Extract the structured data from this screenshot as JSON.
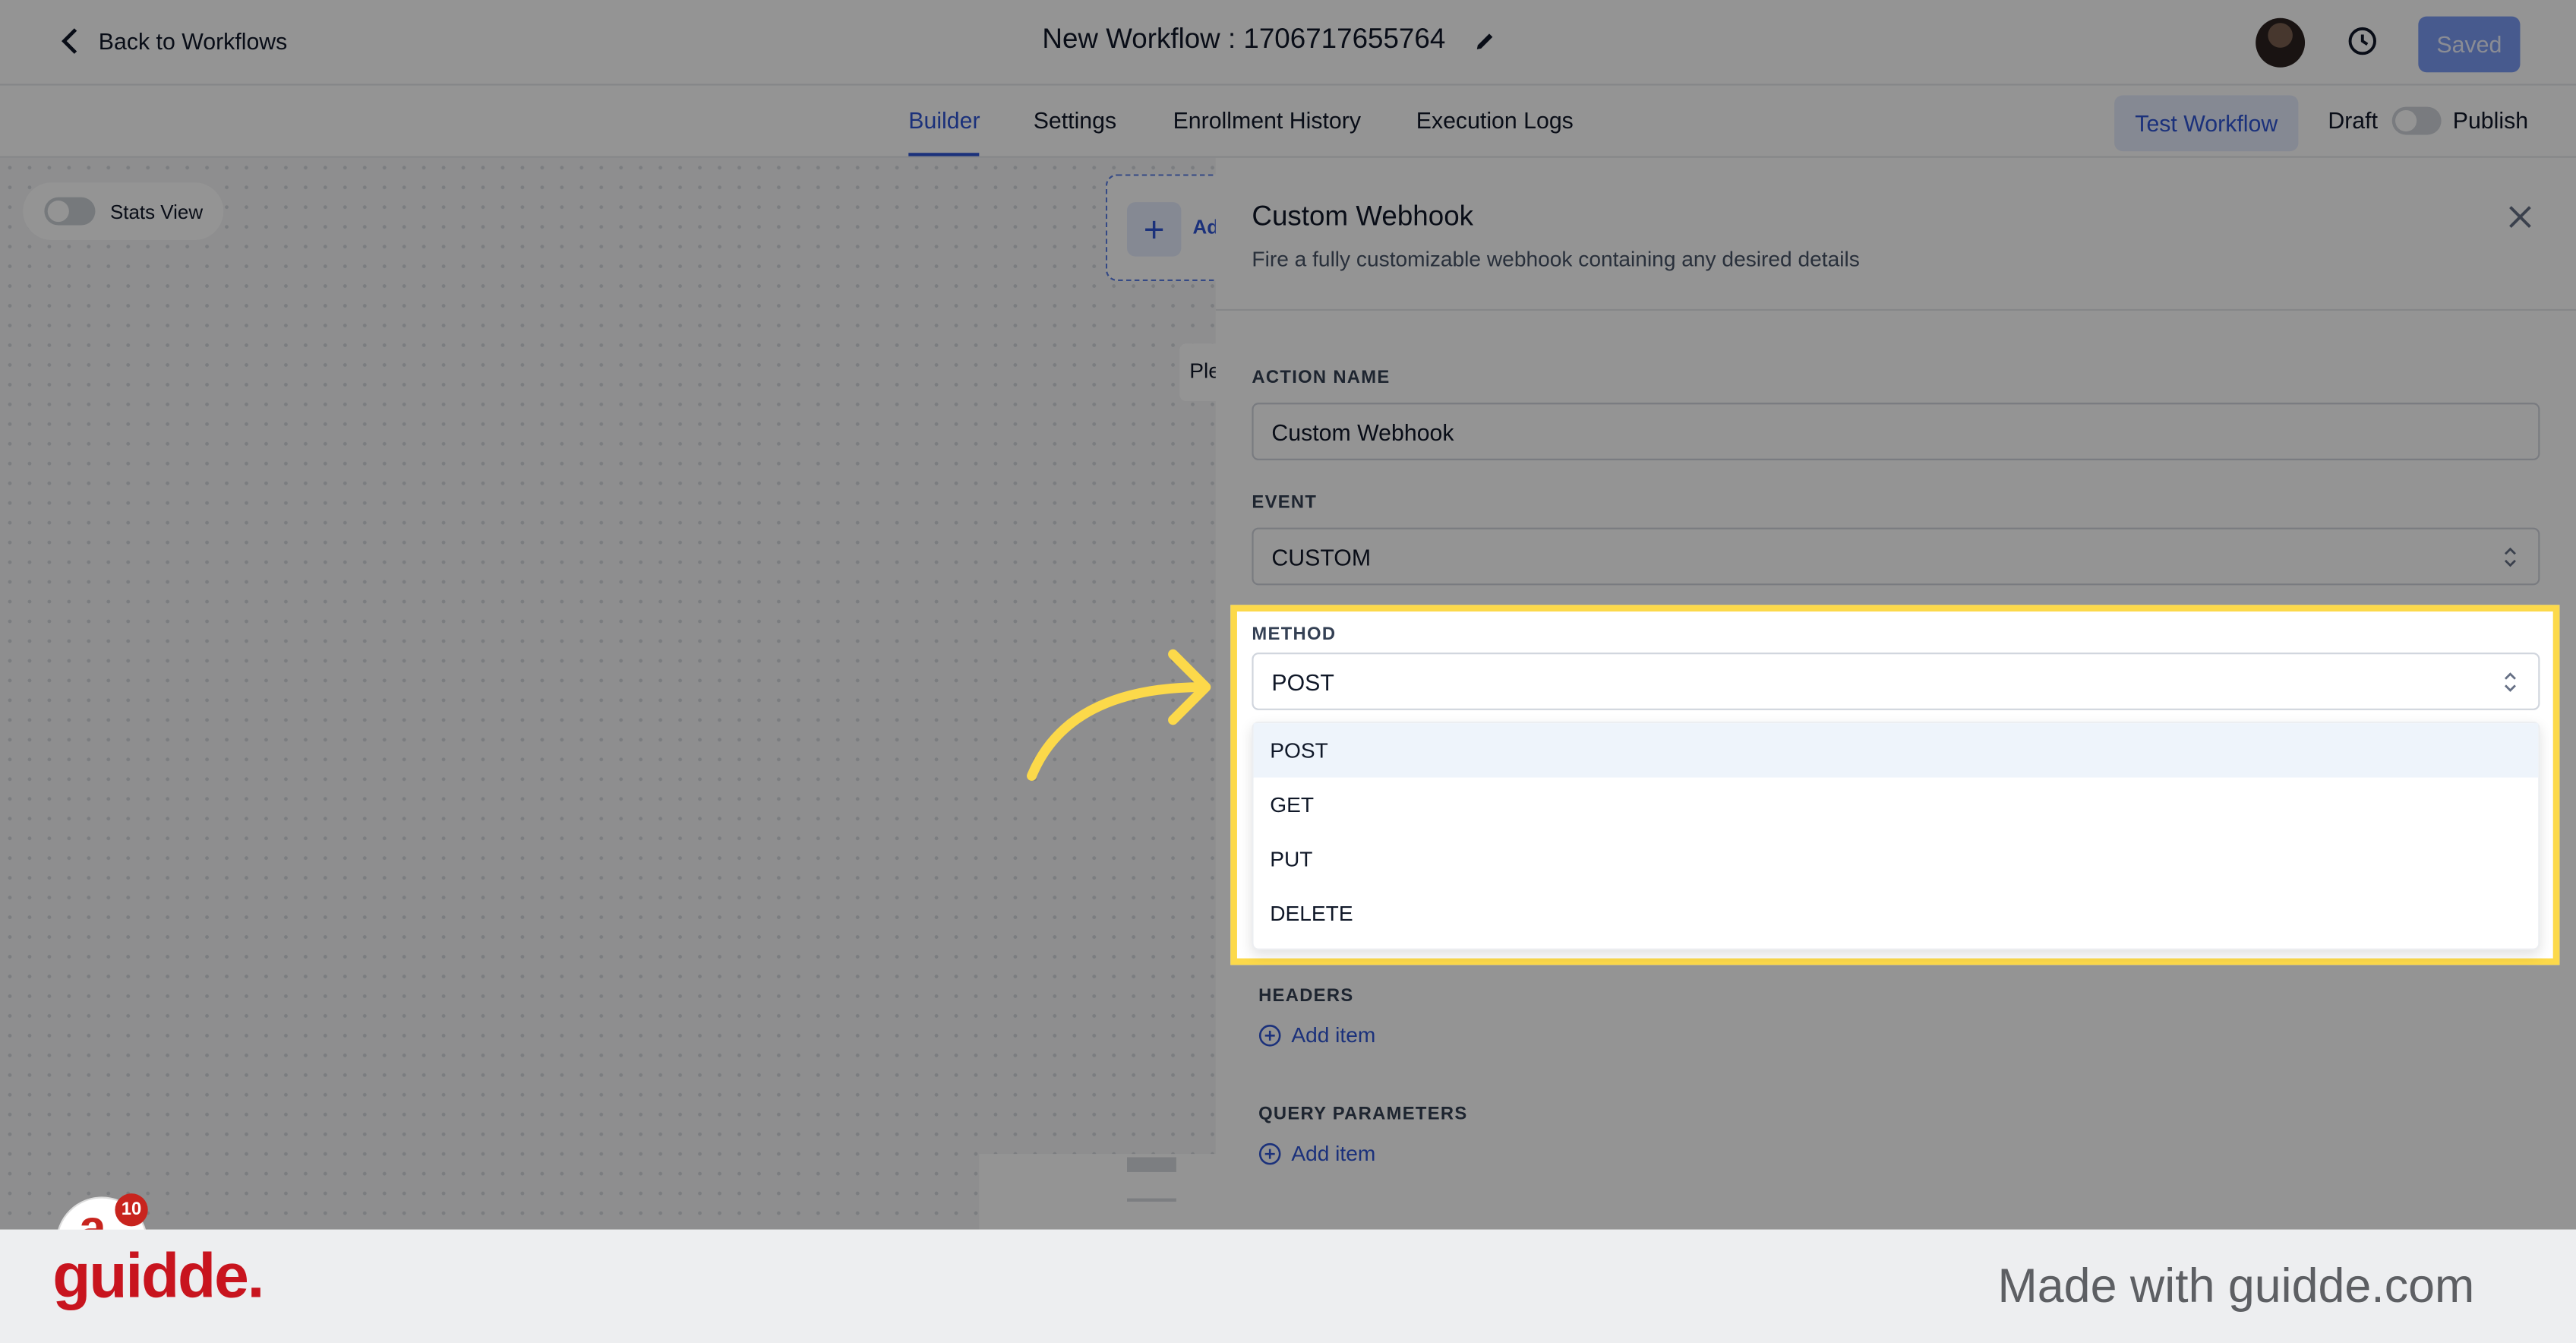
{
  "header": {
    "back_label": "Back to Workflows",
    "workflow_title": "New Workflow : 1706717655764",
    "saved_label": "Saved"
  },
  "tabs": [
    {
      "label": "Builder",
      "active": true
    },
    {
      "label": "Settings",
      "active": false
    },
    {
      "label": "Enrollment History",
      "active": false
    },
    {
      "label": "Execution Logs",
      "active": false
    }
  ],
  "toolbar": {
    "test_label": "Test Workflow",
    "draft_label": "Draft",
    "publish_label": "Publish",
    "publish_on": false
  },
  "canvas": {
    "stats_label": "Stats View",
    "add_node_label": "Ad",
    "partial_text": "Ple",
    "notification_count": "10"
  },
  "panel": {
    "title": "Custom Webhook",
    "subtitle": "Fire a fully customizable webhook containing any desired details",
    "action_name_label": "ACTION NAME",
    "action_name_value": "Custom Webhook",
    "event_label": "EVENT",
    "event_value": "CUSTOM",
    "method_label": "METHOD",
    "method_value": "POST",
    "method_options": [
      "POST",
      "GET",
      "PUT",
      "DELETE"
    ],
    "headers_label": "HEADERS",
    "headers_add": "Add item",
    "query_label": "QUERY PARAMETERS",
    "query_add": "Add item"
  },
  "footer": {
    "brand": "guidde.",
    "made_with": "Made with guidde.com"
  },
  "colors": {
    "accent": "#2f55d4",
    "highlight": "#fcd94a",
    "brand_red": "#c8141e"
  }
}
